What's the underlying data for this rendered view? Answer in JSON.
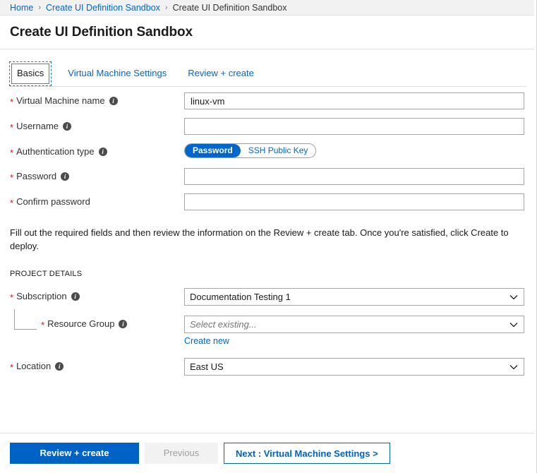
{
  "breadcrumb": {
    "items": [
      {
        "label": "Home",
        "link": true
      },
      {
        "label": "Create UI Definition Sandbox",
        "link": true
      },
      {
        "label": "Create UI Definition Sandbox",
        "link": false
      }
    ],
    "separator": "›"
  },
  "header": {
    "title": "Create UI Definition Sandbox"
  },
  "tabs": [
    {
      "label": "Basics",
      "selected": true
    },
    {
      "label": "Virtual Machine Settings",
      "selected": false
    },
    {
      "label": "Review + create",
      "selected": false
    }
  ],
  "form": {
    "vm_name": {
      "label": "Virtual Machine name",
      "required": "*",
      "info": "i",
      "value": "linux-vm",
      "placeholder": ""
    },
    "username": {
      "label": "Username",
      "required": "*",
      "info": "i",
      "value": "",
      "placeholder": ""
    },
    "auth_type": {
      "label": "Authentication type",
      "required": "*",
      "info": "i",
      "options": [
        {
          "label": "Password",
          "selected": true
        },
        {
          "label": "SSH Public Key",
          "selected": false
        }
      ]
    },
    "password": {
      "label": "Password",
      "required": "*",
      "info": "i",
      "value": "",
      "placeholder": ""
    },
    "confirm_password": {
      "label": "Confirm password",
      "required": "*",
      "value": "",
      "placeholder": ""
    },
    "description": "Fill out the required fields and then review the information on the Review + create tab. Once you're satisfied, click Create to deploy.",
    "project_details_heading": "PROJECT DETAILS",
    "subscription": {
      "label": "Subscription",
      "required": "*",
      "info": "i",
      "value": "Documentation Testing 1",
      "options": [
        "Documentation Testing 1"
      ]
    },
    "resource_group": {
      "label": "Resource Group",
      "required": "*",
      "info": "i",
      "value": "",
      "placeholder": "Select existing...",
      "create_new_label": "Create new",
      "options": [
        "Select existing..."
      ]
    },
    "location": {
      "label": "Location",
      "required": "*",
      "info": "i",
      "value": "East US",
      "options": [
        "East US"
      ]
    }
  },
  "footer": {
    "review_create_label": "Review + create",
    "previous_label": "Previous",
    "next_label": "Next : Virtual Machine Settings >"
  },
  "colors": {
    "accent": "#0062c4",
    "link": "#0066cc",
    "required_asterisk": "#e81123",
    "breadcrumb_bg": "#f2f2f2",
    "border": "#a6a6a6",
    "disabled_bg": "#f2f2f2",
    "disabled_text": "#a19f9d"
  }
}
